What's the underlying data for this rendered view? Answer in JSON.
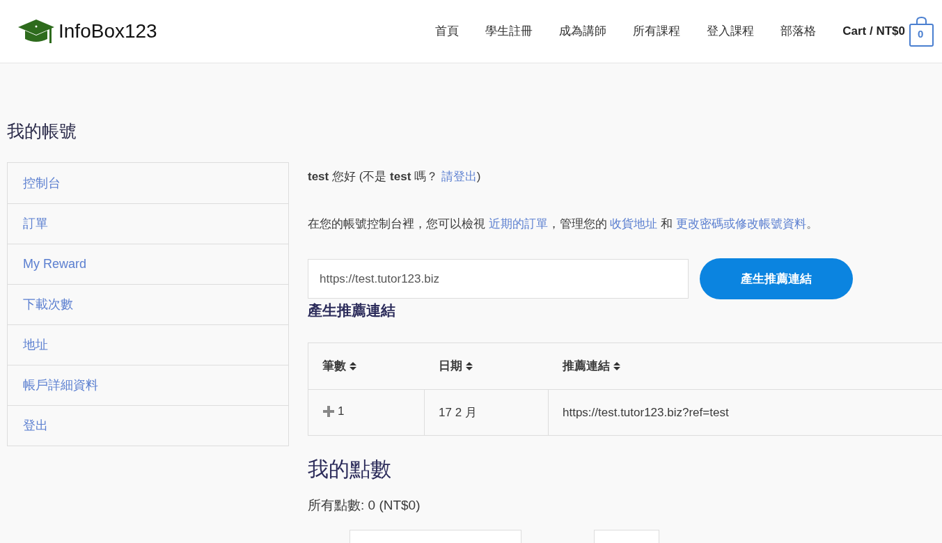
{
  "header": {
    "logo": "InfoBox123",
    "nav": [
      "首頁",
      "學生註冊",
      "成為講師",
      "所有課程",
      "登入課程",
      "部落格"
    ],
    "cart": {
      "label": "Cart / NT$0",
      "count": "0"
    }
  },
  "page_title": "我的帳號",
  "sidebar": {
    "items": [
      "控制台",
      "訂單",
      "My Reward",
      "下載次數",
      "地址",
      "帳戶詳細資料",
      "登出"
    ]
  },
  "greeting": [
    {
      "kind": "text",
      "text": "**test** 您好 (不是 **test** 嗎？ "
    },
    {
      "kind": "link",
      "text": "請登出"
    },
    {
      "kind": "text",
      "text": ")"
    }
  ],
  "intro": [
    {
      "kind": "text",
      "text": "在您的帳號控制台裡，您可以檢視 "
    },
    {
      "kind": "link",
      "text": "近期的訂單"
    },
    {
      "kind": "text",
      "text": "，管理您的 "
    },
    {
      "kind": "link",
      "text": "收貨地址"
    },
    {
      "kind": "text",
      "text": " 和 "
    },
    {
      "kind": "link",
      "text": "更改密碼或修改帳號資料"
    },
    {
      "kind": "text",
      "text": "。"
    }
  ],
  "referral": {
    "url_value": "https://test.tutor123.biz",
    "button": "產生推薦連結",
    "heading": "產生推薦連結"
  },
  "table": {
    "columns": [
      "筆數",
      "日期",
      "推薦連結"
    ],
    "rows": [
      {
        "count": "1",
        "date": "17 2 月",
        "link": "https://test.tutor123.biz?ref=test"
      }
    ]
  },
  "points": {
    "heading": "我的點數",
    "total": "所有點數: 0 (NT$0)"
  }
}
